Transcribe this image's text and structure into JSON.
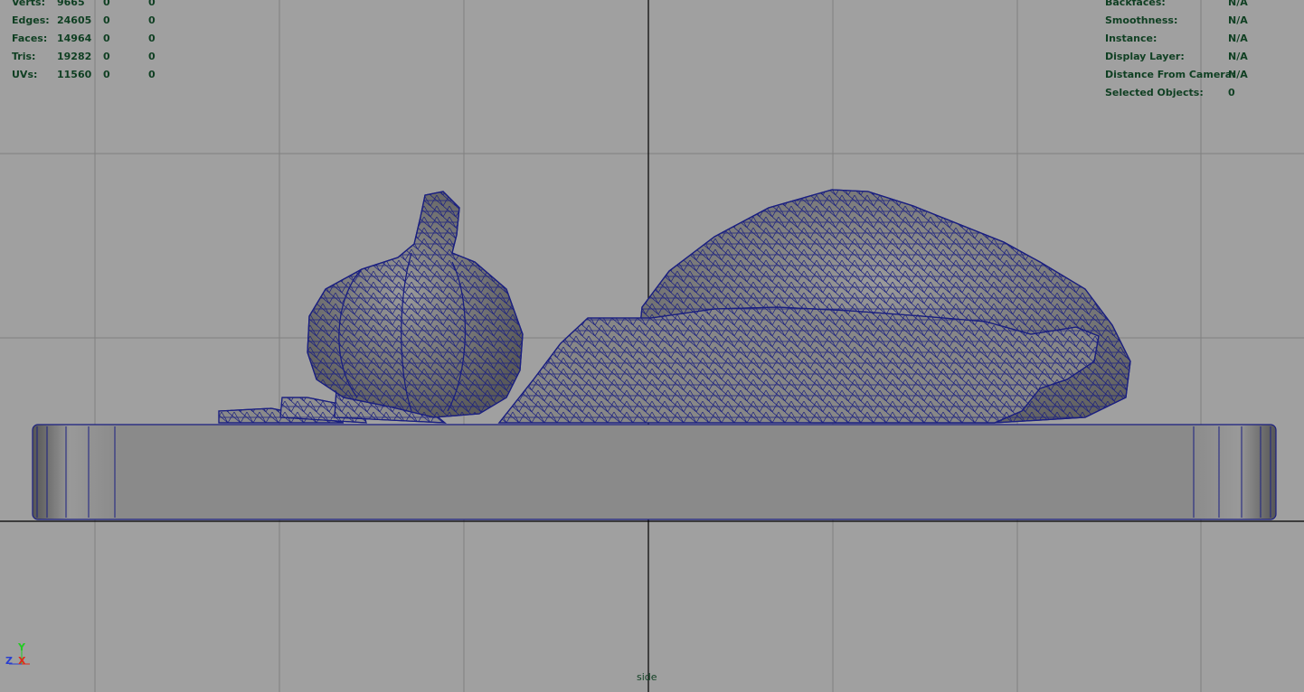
{
  "stats": [
    {
      "label": "Verts:",
      "v1": "9665",
      "v2": "0",
      "v3": "0"
    },
    {
      "label": "Edges:",
      "v1": "24605",
      "v2": "0",
      "v3": "0"
    },
    {
      "label": "Faces:",
      "v1": "14964",
      "v2": "0",
      "v3": "0"
    },
    {
      "label": "Tris:",
      "v1": "19282",
      "v2": "0",
      "v3": "0"
    },
    {
      "label": "UVs:",
      "v1": "11560",
      "v2": "0",
      "v3": "0"
    }
  ],
  "info": [
    {
      "label": "Backfaces:",
      "value": "N/A"
    },
    {
      "label": "Smoothness:",
      "value": "N/A"
    },
    {
      "label": "Instance:",
      "value": "N/A"
    },
    {
      "label": "Display Layer:",
      "value": "N/A"
    },
    {
      "label": "Distance From Camera:",
      "value": "N/A"
    },
    {
      "label": "Selected Objects:",
      "value": "0"
    }
  ],
  "camera": "side",
  "axes": {
    "y": "Y",
    "z": "Z",
    "x": "X"
  },
  "colors": {
    "background": "#a0a0a0",
    "grid": "#808080",
    "axis_line": "#000000",
    "wireframe": "#1a1f80",
    "mesh_fill": "#7d7d7d",
    "hud_text": "#0f3f22"
  }
}
